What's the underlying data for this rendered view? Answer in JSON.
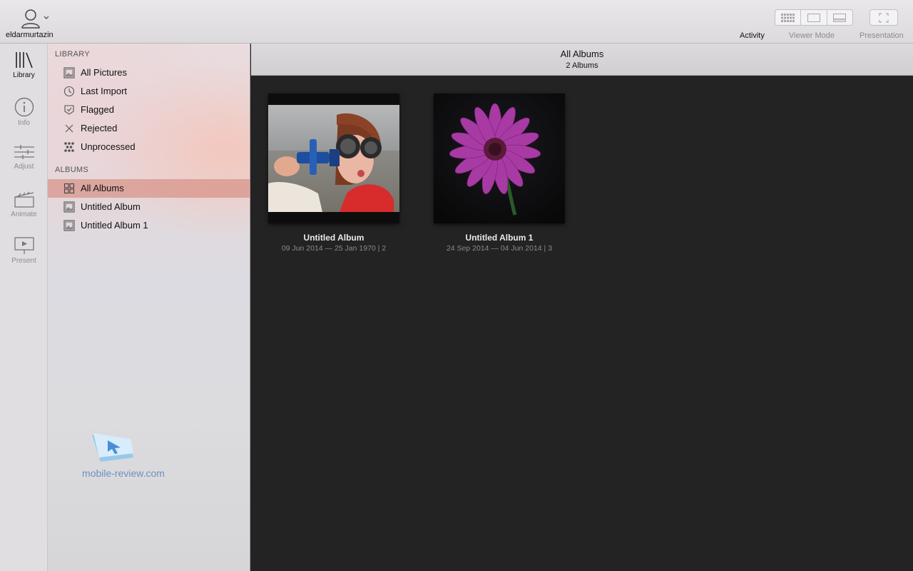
{
  "toolbar": {
    "user_name": "eldarmurtazin",
    "activity_label": "Activity",
    "viewer_mode_label": "Viewer Mode",
    "presentation_label": "Presentation"
  },
  "rail": {
    "items": [
      {
        "label": "Library",
        "icon": "library-icon",
        "active": true
      },
      {
        "label": "Info",
        "icon": "info-icon",
        "active": false
      },
      {
        "label": "Adjust",
        "icon": "adjust-icon",
        "active": false
      },
      {
        "label": "Animate",
        "icon": "animate-icon",
        "active": false
      },
      {
        "label": "Present",
        "icon": "present-icon",
        "active": false
      }
    ]
  },
  "sidebar": {
    "library_header": "LIBRARY",
    "library_items": [
      {
        "label": "All Pictures",
        "icon": "pictures-icon"
      },
      {
        "label": "Last Import",
        "icon": "clock-icon"
      },
      {
        "label": "Flagged",
        "icon": "flag-icon"
      },
      {
        "label": "Rejected",
        "icon": "x-icon"
      },
      {
        "label": "Unprocessed",
        "icon": "dots-icon"
      }
    ],
    "albums_header": "ALBUMS",
    "album_items": [
      {
        "label": "All Albums",
        "icon": "grid-icon",
        "selected": true
      },
      {
        "label": "Untitled Album",
        "icon": "album-icon",
        "selected": false
      },
      {
        "label": "Untitled Album 1",
        "icon": "album-icon",
        "selected": false
      }
    ]
  },
  "watermark": "mobile-review.com",
  "main": {
    "title": "All Albums",
    "subtitle": "2 Albums",
    "albums": [
      {
        "name": "Untitled Album",
        "dates": "09 Jun 2014 — 25 Jan 1970 | 2",
        "thumb": "child-pilot-photo"
      },
      {
        "name": "Untitled Album 1",
        "dates": "24 Sep 2014 — 04 Jun 2014 | 3",
        "thumb": "purple-flower-photo"
      }
    ]
  },
  "colors": {
    "selection": "#d68c80",
    "main_bg": "#232323",
    "toolbar_bg": "#e2e0e3"
  }
}
